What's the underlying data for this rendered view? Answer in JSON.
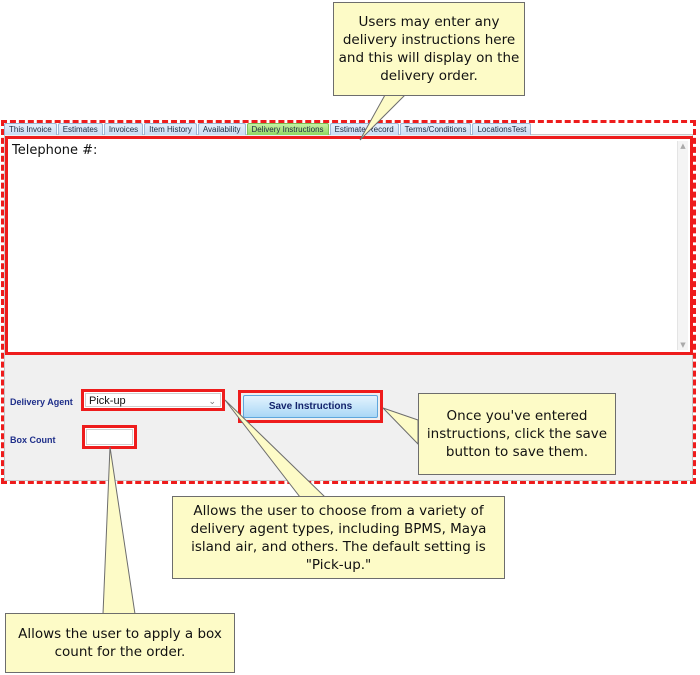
{
  "tabs": [
    {
      "label": "This Invoice",
      "active": false
    },
    {
      "label": "Estimates",
      "active": false
    },
    {
      "label": "Invoices",
      "active": false
    },
    {
      "label": "Item History",
      "active": false
    },
    {
      "label": "Availability",
      "active": false
    },
    {
      "label": "Delivery Instructions",
      "active": true
    },
    {
      "label": "Estimate Record",
      "active": false
    },
    {
      "label": "Terms/Conditions",
      "active": false
    },
    {
      "label": "LocationsTest",
      "active": false
    }
  ],
  "instructions": {
    "value": "Telephone #:"
  },
  "form": {
    "delivery_agent_label": "Delivery Agent",
    "delivery_agent_value": "Pick-up",
    "box_count_label": "Box Count",
    "box_count_value": "",
    "save_label": "Save Instructions"
  },
  "callouts": {
    "instructions": "Users may enter any delivery instructions here and this will display on the delivery order.",
    "save": "Once you've entered instructions, click the save button to save them.",
    "agent": "Allows the user to choose from a variety of delivery agent types, including BPMS, Maya island air, and others. The default setting is \"Pick-up.\"",
    "box_count": "Allows the user to apply a box count for the order."
  },
  "colors": {
    "highlight": "#ee1c1c",
    "callout_bg": "#fdfbc7",
    "active_tab": "#8fd860",
    "label_text": "#1f2f8a"
  }
}
